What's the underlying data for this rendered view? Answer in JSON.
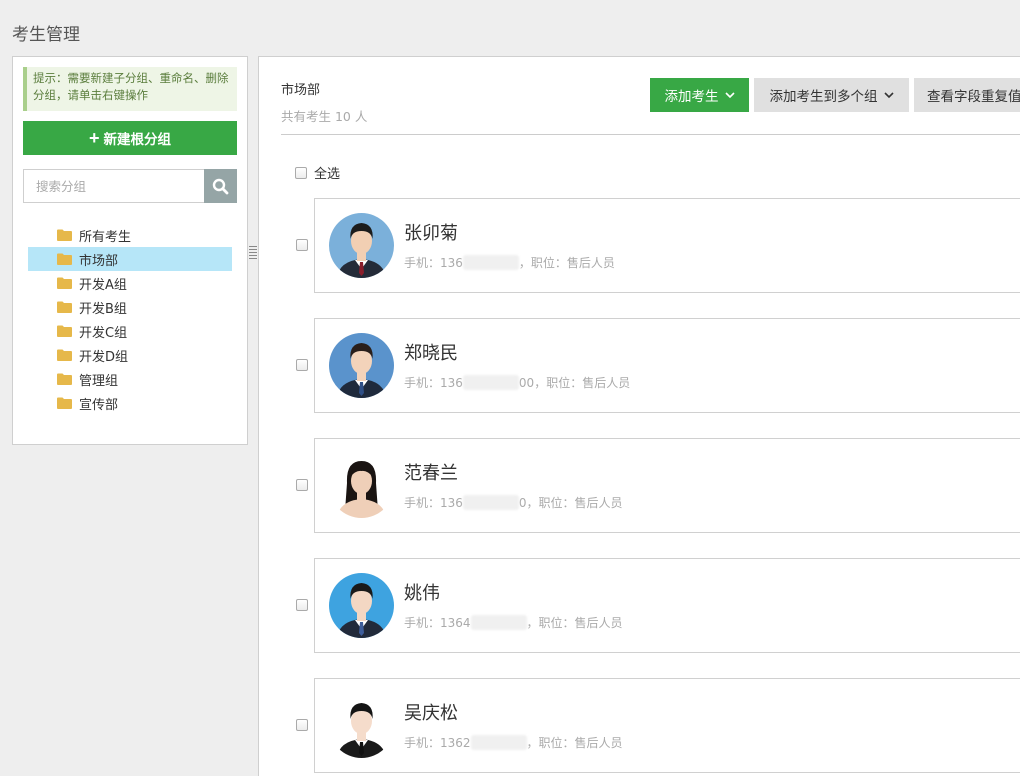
{
  "page": {
    "title": "考生管理"
  },
  "left": {
    "tip": "提示：需要新建子分组、重命名、删除分组，请单击右键操作",
    "new_root_label": "新建根分组",
    "search_placeholder": "搜索分组",
    "tree": [
      {
        "label": "所有考生",
        "active": false
      },
      {
        "label": "市场部",
        "active": true
      },
      {
        "label": "开发A组",
        "active": false
      },
      {
        "label": "开发B组",
        "active": false
      },
      {
        "label": "开发C组",
        "active": false
      },
      {
        "label": "开发D组",
        "active": false
      },
      {
        "label": "管理组",
        "active": false
      },
      {
        "label": "宣传部",
        "active": false
      }
    ]
  },
  "right": {
    "group_name": "市场部",
    "group_count": "共有考生 10 人",
    "buttons": {
      "add": "添加考生",
      "add_multi": "添加考生到多个组",
      "check_dup": "查看字段重复值"
    },
    "select_all": "全选",
    "cards": [
      {
        "name": "张卯菊",
        "phone_prefix": "手机：136",
        "phone_suffix": "",
        "role": "，职位：售后人员"
      },
      {
        "name": "郑晓民",
        "phone_prefix": "手机：136",
        "phone_suffix": "00",
        "role": "，职位：售后人员"
      },
      {
        "name": "范春兰",
        "phone_prefix": "手机：136",
        "phone_suffix": "0",
        "role": "，职位：售后人员"
      },
      {
        "name": "姚伟",
        "phone_prefix": "手机：1364",
        "phone_suffix": "",
        "role": "，职位：售后人员"
      },
      {
        "name": "吴庆松",
        "phone_prefix": "手机：1362",
        "phone_suffix": "",
        "role": "，职位：售后人员"
      }
    ]
  },
  "colors": {
    "accent_green": "#38a845",
    "active_blue": "#b6e6f8",
    "folder": "#e6b84a"
  },
  "icons": [
    "plus-icon",
    "search-icon",
    "folder-icon",
    "chevron-down-icon",
    "splitter-handle-icon"
  ]
}
